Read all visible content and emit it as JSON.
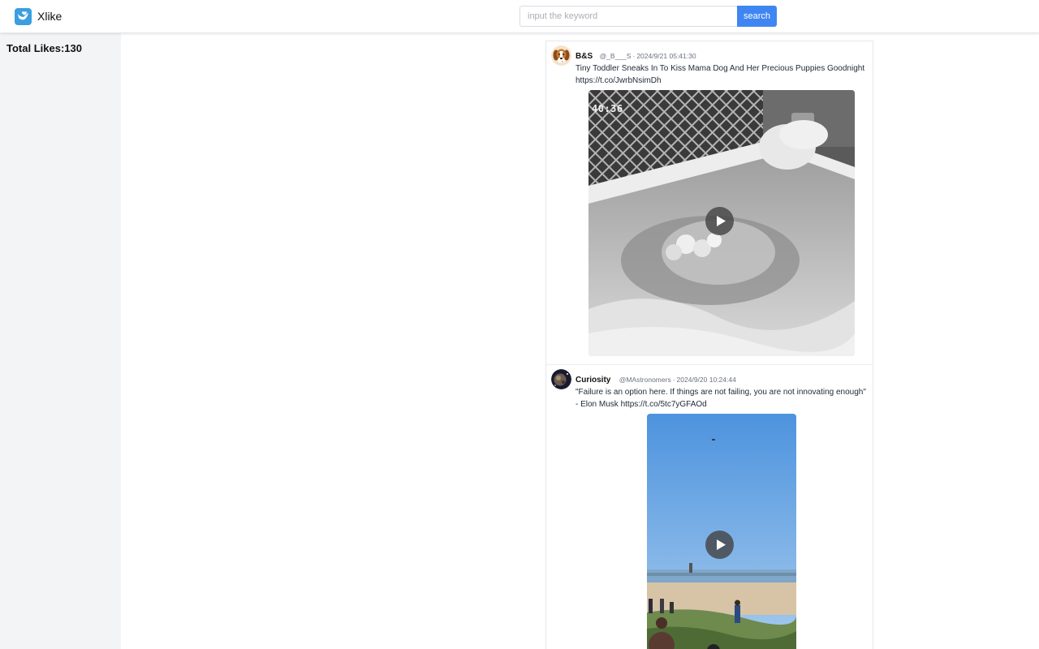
{
  "app": {
    "title": "Xlike",
    "brand_color": "#3b9ee0",
    "logo_icon": "heart-bird-logo-icon"
  },
  "search": {
    "placeholder": "input the keyword",
    "value": "",
    "button_label": "search",
    "button_color": "#3f86f2"
  },
  "sidebar": {
    "total_likes": "Total Likes:130"
  },
  "feed": {
    "tweets": [
      {
        "author": "B&S",
        "handle": "@_B___S",
        "datetime": "2024/9/21 05:41:30",
        "text": "Tiny Toddler Sneaks In To Kiss Mama Dog And Her Precious Puppies Goodnight https://t.co/JwrbNsimDh",
        "avatar_icon": "beagle-avatar",
        "media": {
          "type": "video",
          "overlay_text": "40:36",
          "play_icon": "play-icon"
        }
      },
      {
        "author": "Curiosity",
        "handle": "@MAstronomers",
        "datetime": "2024/9/20 10:24:44",
        "text": "\"Failure is an option here. If things are not failing, you are not innovating enough\" - Elon Musk https://t.co/5tc7yGFAOd",
        "avatar_icon": "space-avatar",
        "media": {
          "type": "video",
          "play_icon": "play-icon"
        }
      }
    ]
  }
}
